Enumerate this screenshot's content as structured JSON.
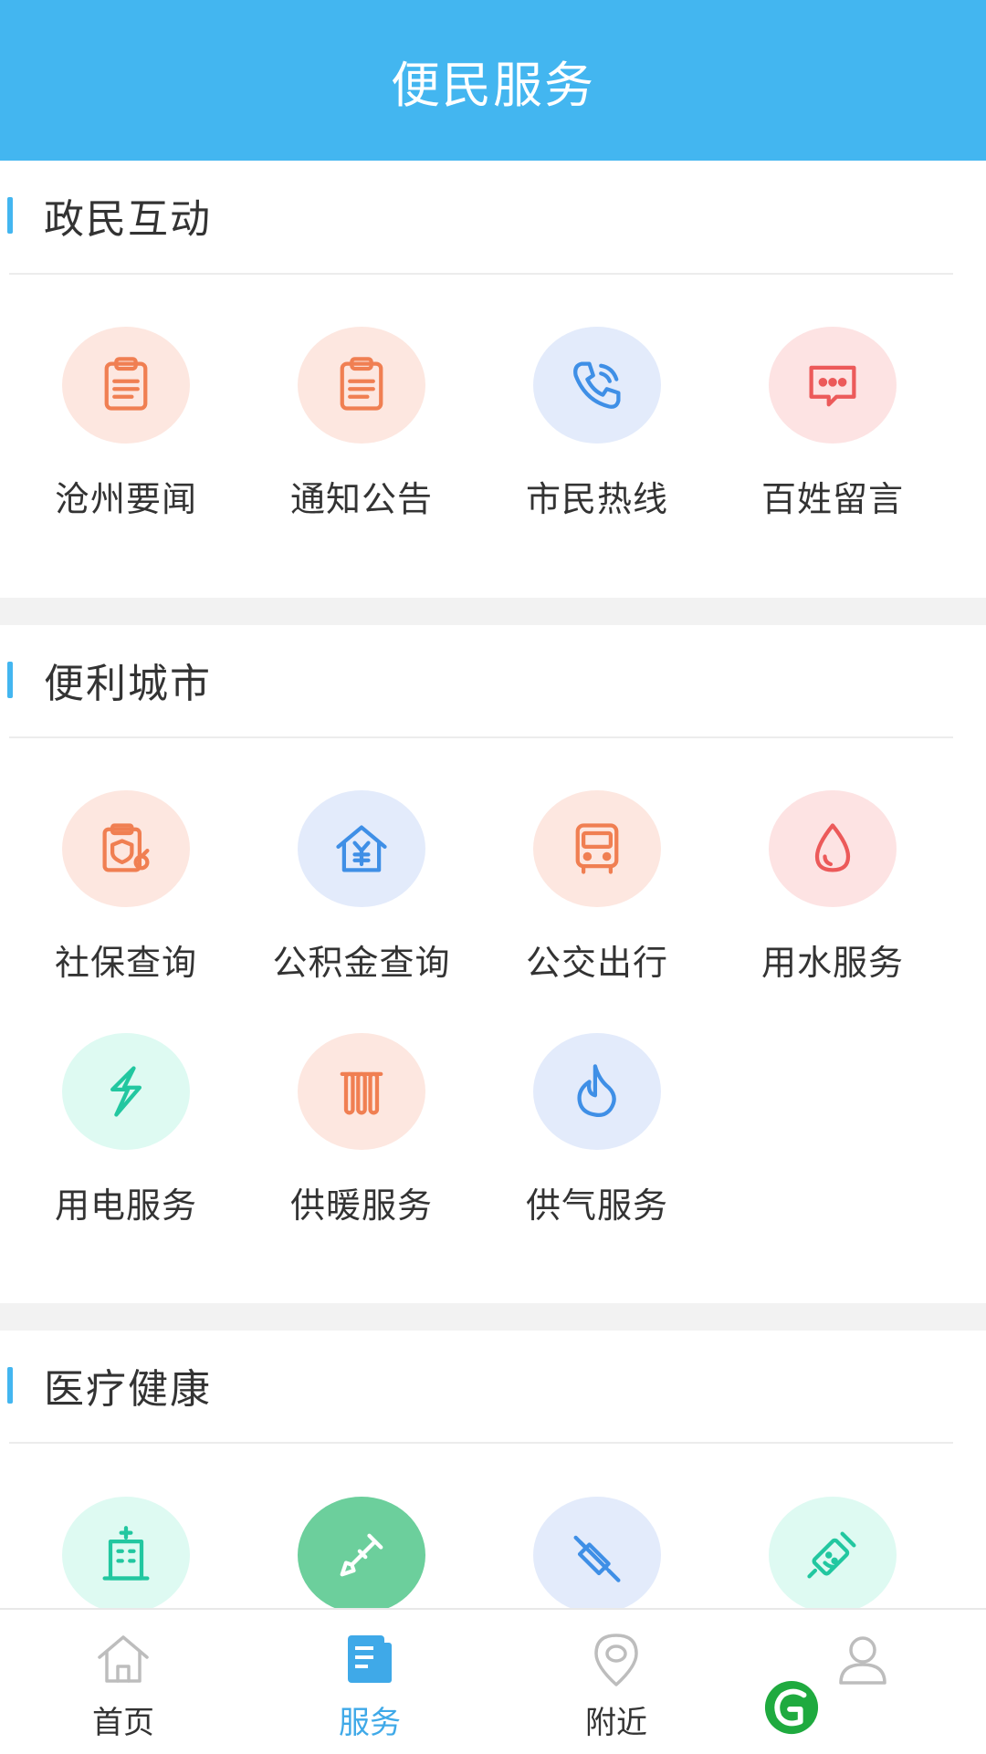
{
  "header": {
    "title": "便民服务"
  },
  "sections": [
    {
      "title": "政民互动",
      "items": [
        {
          "label": "沧州要闻",
          "icon": "clipboard-icon",
          "color": "#f07f52"
        },
        {
          "label": "通知公告",
          "icon": "clipboard-icon",
          "color": "#f07f52"
        },
        {
          "label": "市民热线",
          "icon": "phone-icon",
          "color": "#3f8fe6"
        },
        {
          "label": "百姓留言",
          "icon": "chat-bubble-icon",
          "color": "#ec5a5a"
        }
      ]
    },
    {
      "title": "便利城市",
      "items": [
        {
          "label": "社保查询",
          "icon": "social-security-icon",
          "color": "#f07f52"
        },
        {
          "label": "公积金查询",
          "icon": "house-fund-icon",
          "color": "#3f8fe6"
        },
        {
          "label": "公交出行",
          "icon": "bus-icon",
          "color": "#f07f52"
        },
        {
          "label": "用水服务",
          "icon": "water-drop-icon",
          "color": "#ec5a5a"
        },
        {
          "label": "用电服务",
          "icon": "lightning-icon",
          "color": "#22c7a0"
        },
        {
          "label": "供暖服务",
          "icon": "radiator-icon",
          "color": "#f07f52"
        },
        {
          "label": "供气服务",
          "icon": "flame-icon",
          "color": "#3f8fe6"
        }
      ]
    },
    {
      "title": "医疗健康",
      "items": [
        {
          "label": "",
          "icon": "hospital-icon",
          "color": "#22c7a0"
        },
        {
          "label": "",
          "icon": "syringe-icon",
          "color": "#ffffff"
        },
        {
          "label": "",
          "icon": "syringe-icon",
          "color": "#3f8fe6"
        },
        {
          "label": "",
          "icon": "smile-syringe-icon",
          "color": "#22c7a0"
        }
      ]
    }
  ],
  "tabbar": {
    "tabs": [
      {
        "label": "首页",
        "icon": "home-icon"
      },
      {
        "label": "服务",
        "icon": "service-doc-icon",
        "active": true
      },
      {
        "label": "附近",
        "icon": "location-icon"
      },
      {
        "label": "",
        "icon": "user-icon"
      }
    ]
  },
  "colors": {
    "header": "#43b6f0",
    "accent": "#3fa9e8"
  }
}
